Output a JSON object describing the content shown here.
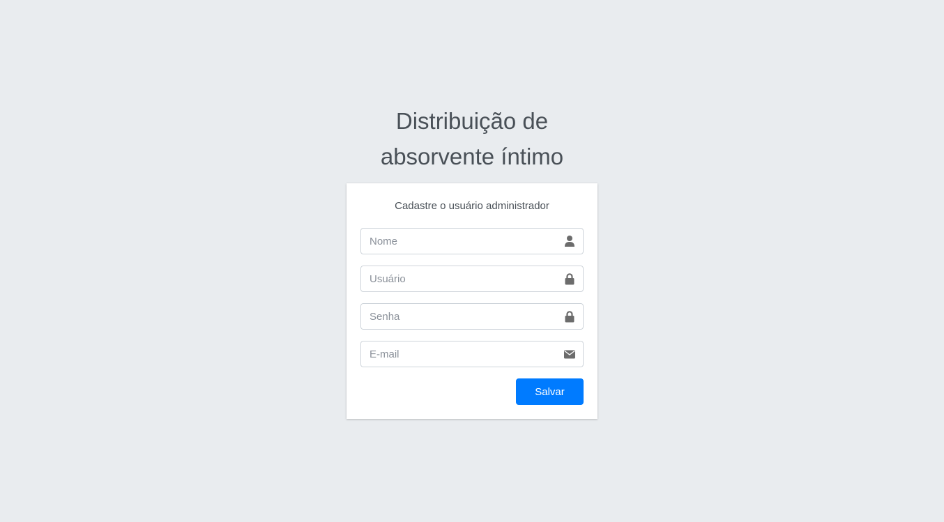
{
  "header": {
    "title_line1": "Distribuição de",
    "title_line2": "absorvente íntimo"
  },
  "card": {
    "message": "Cadastre o usuário administrador",
    "fields": {
      "nome": {
        "placeholder": "Nome",
        "value": "",
        "icon": "user-icon"
      },
      "usuario": {
        "placeholder": "Usuário",
        "value": "",
        "icon": "lock-icon"
      },
      "senha": {
        "placeholder": "Senha",
        "value": "",
        "icon": "lock-icon"
      },
      "email": {
        "placeholder": "E-mail",
        "value": "",
        "icon": "envelope-icon"
      }
    },
    "submit_label": "Salvar"
  },
  "colors": {
    "background": "#e9ecef",
    "primary": "#007bff",
    "text": "#495057",
    "icon": "#6c6c6c"
  }
}
